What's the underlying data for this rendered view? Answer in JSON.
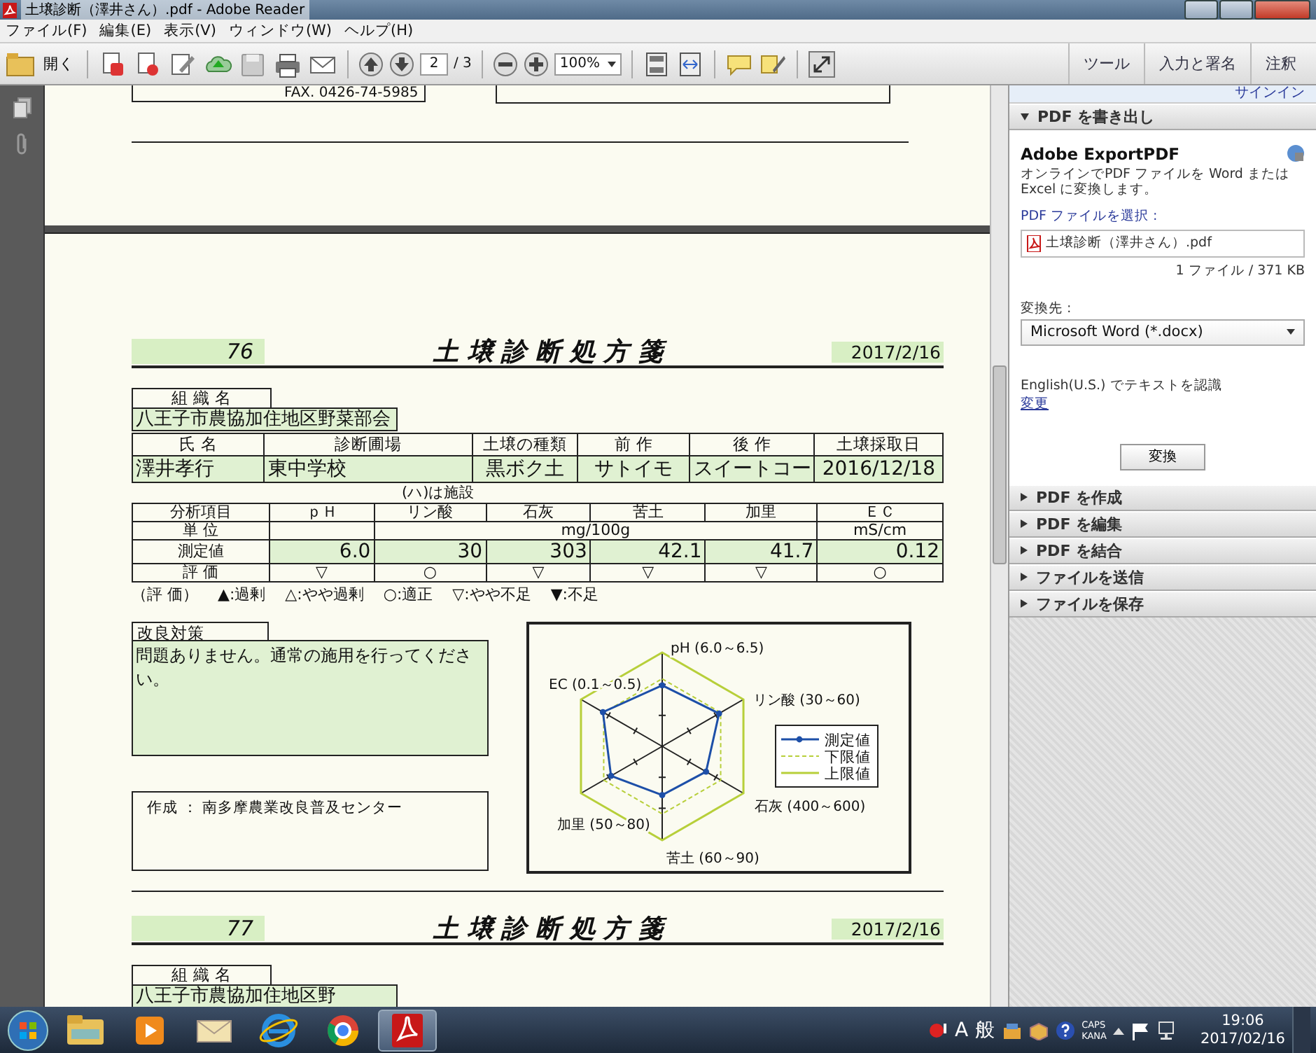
{
  "window": {
    "title": "土壌診断（澤井さん）.pdf - Adobe Reader"
  },
  "menu": [
    "ファイル(F)",
    "編集(E)",
    "表示(V)",
    "ウィンドウ(W)",
    "ヘルプ(H)"
  ],
  "toolbar": {
    "open_label": "開く",
    "page": "2",
    "page_total": "/ 3",
    "zoom": "100%",
    "right_buttons": [
      "ツール",
      "入力と署名",
      "注釈"
    ]
  },
  "document": {
    "previous_page": {
      "fax": "FAX. 0426-74-5985"
    },
    "sheets": [
      {
        "number": "76",
        "title": "土 壌 診 断 処 方 箋",
        "date": "2017/2/16",
        "org_label": "組 織 名",
        "org": "八王子市農協加住地区野菜部会",
        "info_headers": [
          "氏 名",
          "診断圃場",
          "土壌の種類",
          "前 作",
          "後 作",
          "土壌採取日"
        ],
        "info_values": [
          "澤井孝行",
          "東中学校",
          "黒ボク土",
          "サトイモ",
          "スイートコー",
          "2016/12/18"
        ],
        "facility_note": "(ハ)は施設",
        "analysis": {
          "headers": [
            "分析項目",
            "ｐＨ",
            "リン酸",
            "石灰",
            "苦土",
            "加里",
            "ＥＣ"
          ],
          "unit_label": "単 位",
          "unit_mass": "mg/100g",
          "unit_ec": "mS/cm",
          "measured_label": "測定値",
          "values": [
            "6.0",
            "30",
            "303",
            "42.1",
            "41.7",
            "0.12"
          ],
          "evaluation_label": "評 価",
          "evaluations": [
            "▽",
            "○",
            "▽",
            "▽",
            "▽",
            "○"
          ]
        },
        "legend": [
          "（評 価）",
          "▲:過剰",
          "△:やや過剰",
          "○:適正",
          "▽:やや不足",
          "▼:不足"
        ],
        "remedy_label": "改良対策",
        "remedy_text": "問題ありません。通常の施用を行ってください。",
        "author": "作成 ： 南多摩農業改良普及センター",
        "chart": {
          "axis_labels": [
            "pH (6.0～6.5)",
            "EC (0.1～0.5)",
            "リン酸 (30～60)",
            "石灰 (400～600)",
            "加里 (50～80)",
            "苦土 (60～90)"
          ],
          "legend": [
            {
              "label": "測定値",
              "kind": "measured"
            },
            {
              "label": "下限値",
              "kind": "lower"
            },
            {
              "label": "上限値",
              "kind": "upper"
            }
          ]
        }
      },
      {
        "number": "77",
        "title": "土 壌 診 断 処 方 箋",
        "date": "2017/2/16",
        "org_label": "組 織 名",
        "org": "八王子市農協加住地区野"
      }
    ]
  },
  "panel": {
    "sign_in": "サインイン",
    "sections": [
      {
        "label": "PDF を書き出し",
        "expanded": true
      },
      {
        "label": "PDF を作成",
        "expanded": false
      },
      {
        "label": "PDF を編集",
        "expanded": false
      },
      {
        "label": "PDF を結合",
        "expanded": false
      },
      {
        "label": "ファイルを送信",
        "expanded": false
      },
      {
        "label": "ファイルを保存",
        "expanded": false
      }
    ],
    "export": {
      "title": "Adobe ExportPDF",
      "description": "オンラインでPDF ファイルを Word または Excel に変換します。",
      "select_label": "PDF ファイルを選択 :",
      "file": "土壌診断（澤井さん）.pdf",
      "file_info": "1 ファイル / 371 KB",
      "convert_label": "変換先 :",
      "format": "Microsoft Word (*.docx)",
      "ocr_text": "English(U.S.) でテキストを認識",
      "change_link": "変更",
      "convert_button": "変換"
    }
  },
  "taskbar": {
    "apps": [
      {
        "kind": "explorer",
        "selected": false
      },
      {
        "kind": "media",
        "selected": false
      },
      {
        "kind": "mail",
        "selected": false
      },
      {
        "kind": "ie",
        "selected": false
      },
      {
        "kind": "chrome",
        "selected": false
      },
      {
        "kind": "acrobat",
        "selected": true
      }
    ],
    "tray": {
      "ime_mode": "A",
      "ime_kanji": "般",
      "caps": "CAPS",
      "kana": "KANA",
      "time": "19:06",
      "date": "2017/02/16"
    }
  }
}
